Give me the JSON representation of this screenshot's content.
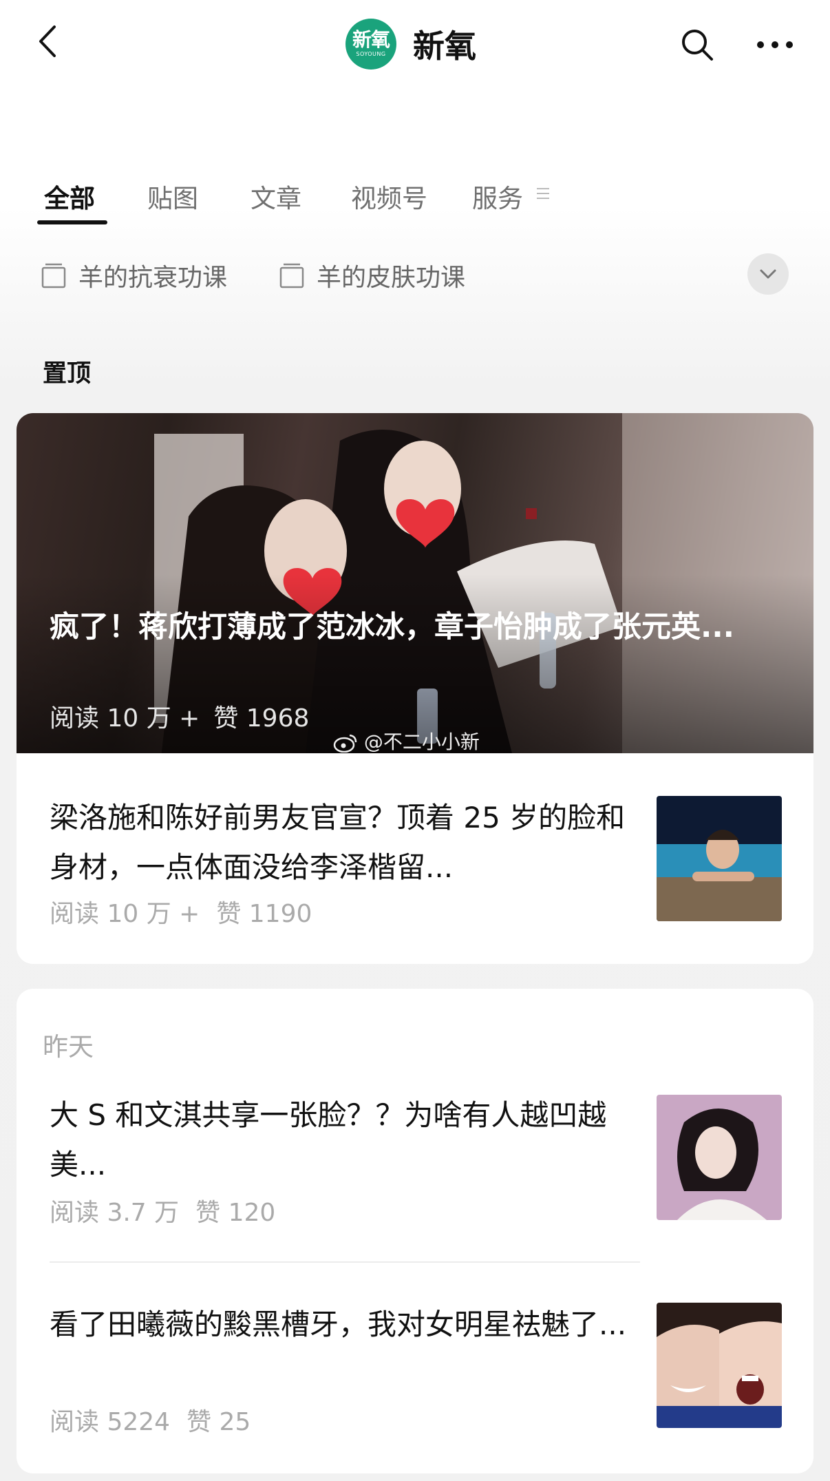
{
  "header": {
    "account_name": "新氧",
    "logo_text": "新氧",
    "logo_subtext": "SOYOUNG"
  },
  "tabs": [
    {
      "label": "全部",
      "active": true
    },
    {
      "label": "贴图"
    },
    {
      "label": "文章"
    },
    {
      "label": "视频号"
    },
    {
      "label": "服务"
    }
  ],
  "collections": [
    {
      "label": "羊的抗衰功课"
    },
    {
      "label": "羊的皮肤功课"
    }
  ],
  "pinned": {
    "section_title": "置顶",
    "featured": {
      "title": "疯了！蒋欣打薄成了范冰冰，章子怡肿成了张元英...",
      "reads": "阅读 10 万 +",
      "likes": "赞 1968",
      "watermark": "@不二小小新"
    },
    "article": {
      "title": "梁洛施和陈好前男友官宣？顶着 25 岁的脸和身材，一点体面没给李泽楷留...",
      "reads": "阅读 10 万 +",
      "likes": "赞 1190"
    }
  },
  "yesterday": {
    "label": "昨天",
    "articles": [
      {
        "title": "大 S 和文淇共享一张脸？？为啥有人越凹越美...",
        "reads": "阅读 3.7 万",
        "likes": "赞 120"
      },
      {
        "title": "看了田曦薇的黢黑槽牙，我对女明星祛魅了...",
        "reads": "阅读 5224",
        "likes": "赞 25"
      }
    ]
  },
  "colors": {
    "brand_green": "#1aa37c",
    "text_primary": "#111111",
    "text_secondary": "#aaaaaa"
  }
}
